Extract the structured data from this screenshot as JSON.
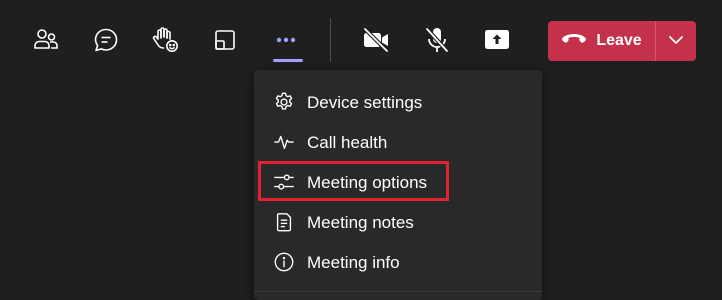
{
  "toolbar": {
    "buttons": [
      {
        "name": "people-icon"
      },
      {
        "name": "chat-icon"
      },
      {
        "name": "raise-hand-icon"
      },
      {
        "name": "view-icon"
      },
      {
        "name": "more-icon"
      },
      {
        "name": "camera-off-icon"
      },
      {
        "name": "mic-off-icon"
      },
      {
        "name": "share-icon"
      }
    ],
    "leave_label": "Leave",
    "accent": "#9ea2ff",
    "leave_color": "#c4314b"
  },
  "more_menu": {
    "items": [
      {
        "label": "Device settings",
        "icon": "gear-icon"
      },
      {
        "label": "Call health",
        "icon": "pulse-icon"
      },
      {
        "label": "Meeting options",
        "icon": "sliders-icon",
        "highlighted": true
      },
      {
        "label": "Meeting notes",
        "icon": "notes-icon"
      },
      {
        "label": "Meeting info",
        "icon": "info-icon"
      }
    ]
  },
  "annotation": {
    "highlight_color": "#e0232e"
  }
}
